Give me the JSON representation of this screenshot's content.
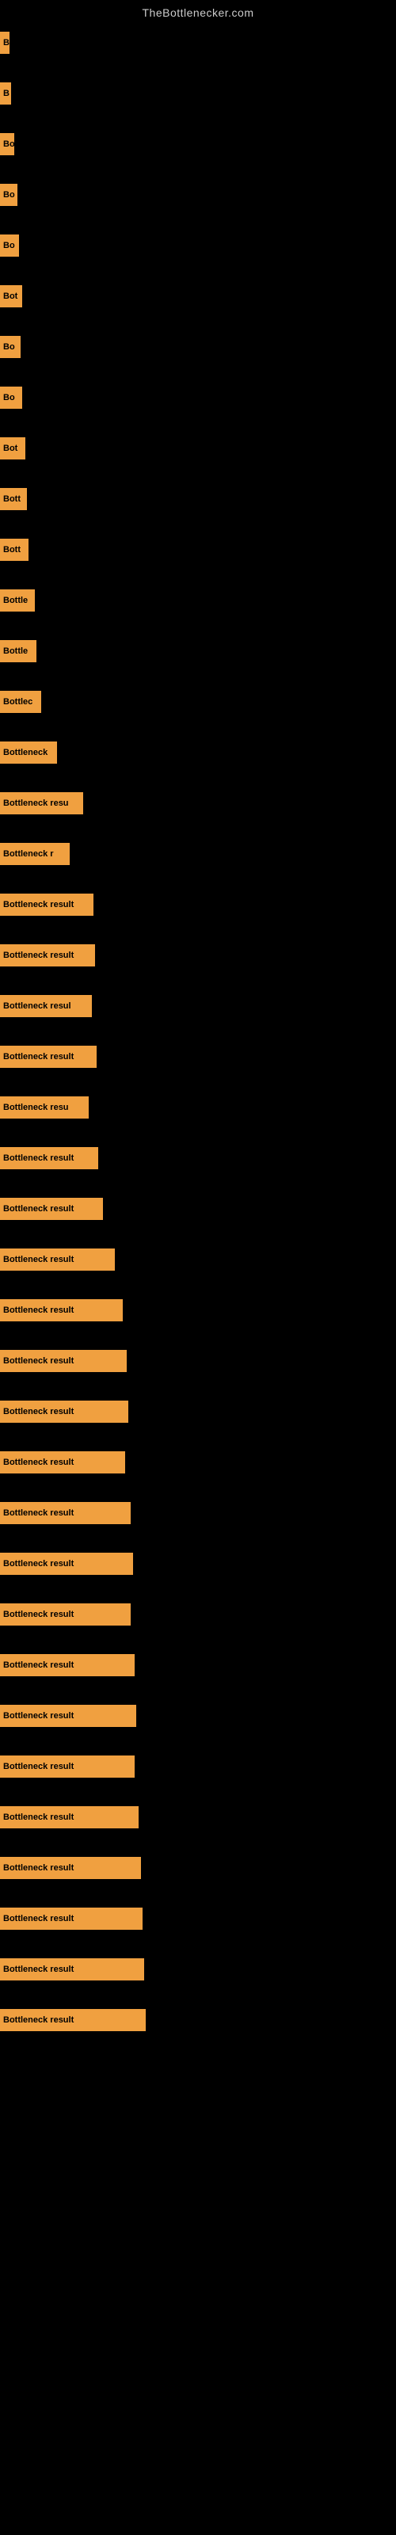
{
  "site_title": "TheBottlenecker.com",
  "bars": [
    {
      "label": "B",
      "width": 12,
      "top_gap": 10
    },
    {
      "label": "B",
      "width": 14,
      "top_gap": 60
    },
    {
      "label": "Bo",
      "width": 18,
      "top_gap": 60
    },
    {
      "label": "Bo",
      "width": 22,
      "top_gap": 60
    },
    {
      "label": "Bo",
      "width": 24,
      "top_gap": 60
    },
    {
      "label": "Bot",
      "width": 28,
      "top_gap": 60
    },
    {
      "label": "Bo",
      "width": 26,
      "top_gap": 60
    },
    {
      "label": "Bo",
      "width": 28,
      "top_gap": 60
    },
    {
      "label": "Bot",
      "width": 32,
      "top_gap": 60
    },
    {
      "label": "Bott",
      "width": 34,
      "top_gap": 60
    },
    {
      "label": "Bott",
      "width": 36,
      "top_gap": 60
    },
    {
      "label": "Bottle",
      "width": 44,
      "top_gap": 60
    },
    {
      "label": "Bottle",
      "width": 46,
      "top_gap": 60
    },
    {
      "label": "Bottlec",
      "width": 52,
      "top_gap": 60
    },
    {
      "label": "Bottleneck",
      "width": 72,
      "top_gap": 60
    },
    {
      "label": "Bottleneck resu",
      "width": 105,
      "top_gap": 60
    },
    {
      "label": "Bottleneck r",
      "width": 88,
      "top_gap": 60
    },
    {
      "label": "Bottleneck result",
      "width": 118,
      "top_gap": 60
    },
    {
      "label": "Bottleneck result",
      "width": 120,
      "top_gap": 60
    },
    {
      "label": "Bottleneck resul",
      "width": 116,
      "top_gap": 60
    },
    {
      "label": "Bottleneck result",
      "width": 122,
      "top_gap": 60
    },
    {
      "label": "Bottleneck resu",
      "width": 112,
      "top_gap": 60
    },
    {
      "label": "Bottleneck result",
      "width": 124,
      "top_gap": 60
    },
    {
      "label": "Bottleneck result",
      "width": 130,
      "top_gap": 60
    },
    {
      "label": "Bottleneck result",
      "width": 145,
      "top_gap": 60
    },
    {
      "label": "Bottleneck result",
      "width": 155,
      "top_gap": 60
    },
    {
      "label": "Bottleneck result",
      "width": 160,
      "top_gap": 60
    },
    {
      "label": "Bottleneck result",
      "width": 162,
      "top_gap": 60
    },
    {
      "label": "Bottleneck result",
      "width": 158,
      "top_gap": 60
    },
    {
      "label": "Bottleneck result",
      "width": 165,
      "top_gap": 60
    },
    {
      "label": "Bottleneck result",
      "width": 168,
      "top_gap": 60
    },
    {
      "label": "Bottleneck result",
      "width": 165,
      "top_gap": 60
    },
    {
      "label": "Bottleneck result",
      "width": 170,
      "top_gap": 60
    },
    {
      "label": "Bottleneck result",
      "width": 172,
      "top_gap": 60
    },
    {
      "label": "Bottleneck result",
      "width": 170,
      "top_gap": 60
    },
    {
      "label": "Bottleneck result",
      "width": 175,
      "top_gap": 60
    },
    {
      "label": "Bottleneck result",
      "width": 178,
      "top_gap": 60
    },
    {
      "label": "Bottleneck result",
      "width": 180,
      "top_gap": 60
    },
    {
      "label": "Bottleneck result",
      "width": 182,
      "top_gap": 60
    },
    {
      "label": "Bottleneck result",
      "width": 184,
      "top_gap": 60
    }
  ]
}
